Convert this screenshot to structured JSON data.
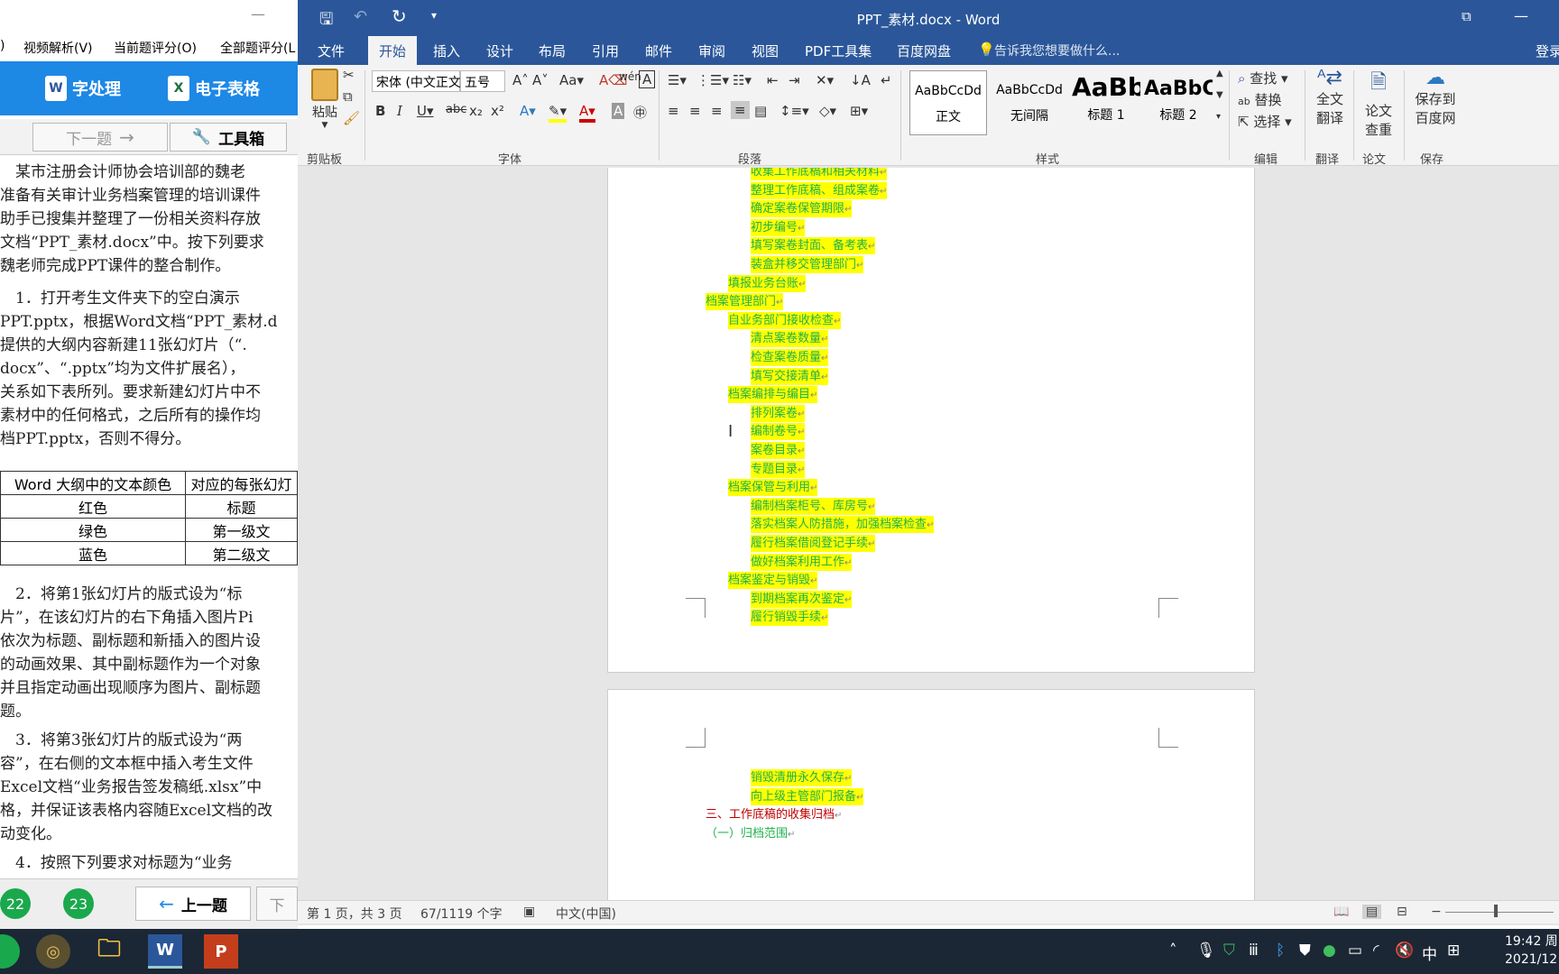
{
  "left_panel": {
    "title_minimize": "—",
    "menu": [
      ")",
      "视频解析(V)",
      "当前题评分(O)",
      "全部题评分(L"
    ],
    "tools": [
      {
        "icon": "W",
        "label": "字处理"
      },
      {
        "icon": "X",
        "label": "电子表格"
      }
    ],
    "nav": {
      "next": "下一题",
      "toolbox": "工具箱"
    },
    "paragraphs": [
      "　某市注册会计师协会培训部的魏老",
      "准备有关审计业务档案管理的培训课件",
      "助手已搜集并整理了一份相关资料存放",
      "文档“PPT_素材.docx”中。按下列要求",
      "魏老师完成PPT课件的整合制作。",
      "　1．打开考生文件夹下的空白演示",
      "PPT.pptx，根据Word文档“PPT_素材.d",
      "提供的大纲内容新建11张幻灯片（“.",
      "docx”、“.pptx”均为文件扩展名），",
      "关系如下表所列。要求新建幻灯片中不",
      "素材中的任何格式，之后所有的操作均",
      "档PPT.pptx，否则不得分。"
    ],
    "table": {
      "headers": [
        "Word 大纲中的文本颜色",
        "对应的每张幻灯"
      ],
      "rows": [
        [
          "红色",
          "标题"
        ],
        [
          "绿色",
          "第一级文"
        ],
        [
          "蓝色",
          "第二级文"
        ]
      ]
    },
    "paragraphs2": [
      "　2．将第1张幻灯片的版式设为“标",
      "片”，在该幻灯片的右下角插入图片Pi",
      "依次为标题、副标题和新插入的图片设",
      "的动画效果、其中副标题作为一个对象",
      "并且指定动画出现顺序为图片、副标题",
      "题。",
      "　3．将第3张幻灯片的版式设为“两",
      "容”，在右侧的文本框中插入考生文件",
      "Excel文档“业务报告签发稿纸.xlsx”中",
      "格，并保证该表格内容随Excel文档的改",
      "动变化。",
      "　4．按照下列要求对标题为“业务"
    ],
    "footer": {
      "circles": [
        "22",
        "23"
      ],
      "prev": "上一题",
      "next_short": "下"
    }
  },
  "word": {
    "title": "PPT_素材.docx - Word",
    "tabs": [
      "文件",
      "开始",
      "插入",
      "设计",
      "布局",
      "引用",
      "邮件",
      "审阅",
      "视图",
      "PDF工具集",
      "百度网盘"
    ],
    "tell_me": "告诉我您想要做什么...",
    "login": "登录",
    "clipboard": {
      "paste": "粘贴",
      "group": "剪贴板"
    },
    "font": {
      "name": "宋体 (中文正文",
      "size": "五号",
      "group": "字体"
    },
    "paragraph_group": "段落",
    "styles": [
      {
        "preview": "AaBbCcDd",
        "name": "正文"
      },
      {
        "preview": "AaBbCcDd",
        "name": "无间隔"
      },
      {
        "preview": "AaBb",
        "name": "标题 1"
      },
      {
        "preview": "AaBbC",
        "name": "标题 2"
      }
    ],
    "styles_group": "样式",
    "editing": {
      "find": "查找",
      "replace": "替换",
      "select": "选择",
      "group": "编辑"
    },
    "translate": {
      "label1": "全文",
      "label2": "翻译",
      "group": "翻译"
    },
    "paper": {
      "label1": "论文",
      "label2": "查重",
      "group": "论文"
    },
    "save_baidu": {
      "label1": "保存到",
      "label2": "百度网",
      "group": "保存"
    },
    "page1_lines": [
      {
        "text": "收集工作底稿和相关材料",
        "level": 2
      },
      {
        "text": "整理工作底稿、组成案卷",
        "level": 2
      },
      {
        "text": "确定案卷保管期限",
        "level": 2
      },
      {
        "text": "初步编号",
        "level": 2
      },
      {
        "text": "填写案卷封面、备考表",
        "level": 2
      },
      {
        "text": "装盒并移交管理部门",
        "level": 2
      },
      {
        "text": "填报业务台账",
        "level": 1
      },
      {
        "text": "档案管理部门",
        "level": 0
      },
      {
        "text": "自业务部门接收检查",
        "level": 1
      },
      {
        "text": "清点案卷数量",
        "level": 2
      },
      {
        "text": "检查案卷质量",
        "level": 2
      },
      {
        "text": "填写交接清单",
        "level": 2
      },
      {
        "text": "档案编排与编目",
        "level": 1
      },
      {
        "text": "排列案卷",
        "level": 2
      },
      {
        "text": "编制卷号",
        "level": 2
      },
      {
        "text": "案卷目录",
        "level": 2
      },
      {
        "text": "专题目录",
        "level": 2
      },
      {
        "text": "档案保管与利用",
        "level": 1
      },
      {
        "text": "编制档案柜号、库房号",
        "level": 2
      },
      {
        "text": "落实档案人防措施，加强档案检查",
        "level": 2
      },
      {
        "text": "履行档案借阅登记手续",
        "level": 2
      },
      {
        "text": "做好档案利用工作",
        "level": 2
      },
      {
        "text": "档案鉴定与销毁",
        "level": 1
      },
      {
        "text": "到期档案再次鉴定",
        "level": 2
      },
      {
        "text": "履行销毁手续",
        "level": 2
      }
    ],
    "page2_lines": [
      {
        "text": "销毁清册永久保存",
        "level": 2,
        "color": "green"
      },
      {
        "text": "向上级主管部门报备",
        "level": 2,
        "color": "green"
      },
      {
        "text": "三、工作底稿的收集归档",
        "level": 0,
        "color": "red"
      },
      {
        "text": "（一）归档范围",
        "level": 0,
        "color": "green-plain"
      }
    ],
    "status": {
      "page": "第 1 页，共 3 页",
      "words": "67/1119 个字",
      "lang": "中文(中国)"
    }
  },
  "taskbar": {
    "clock_time": "19:42 周",
    "clock_date": "2021/12",
    "ime": "中"
  }
}
